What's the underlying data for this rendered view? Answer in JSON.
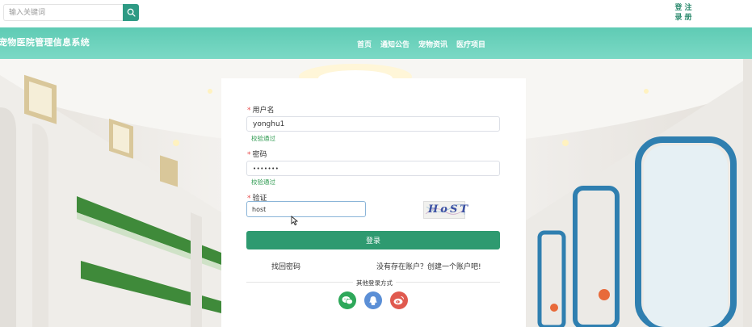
{
  "search": {
    "placeholder": "输入关键词"
  },
  "auth": {
    "login_chars": [
      "登",
      "录"
    ],
    "register_chars": [
      "注",
      "册"
    ]
  },
  "site": {
    "title": "宠物医院管理信息系统"
  },
  "nav": {
    "items": [
      "首页",
      "通知公告",
      "宠物资讯",
      "医疗项目"
    ]
  },
  "form": {
    "username": {
      "label": "用户名",
      "value": "yonghu1",
      "status": "校验通过"
    },
    "password": {
      "label": "密码",
      "value": "•••••••",
      "status": "校验通过"
    },
    "captcha": {
      "label": "验证",
      "value": "host",
      "image_text": "HoST"
    },
    "required_mark": "*",
    "submit_label": "登录",
    "forgot_label": "找回密码",
    "register_label": "没有存在账户？创建一个账户吧!",
    "other_methods_label": "其他登录方式"
  },
  "social": [
    {
      "name": "wechat-icon",
      "color": "#2ea85a"
    },
    {
      "name": "qq-icon",
      "color": "#5b8fd6"
    },
    {
      "name": "weibo-icon",
      "color": "#e05a4f"
    }
  ],
  "colors": {
    "accent": "#2e9a70",
    "header": "#6dd2bd",
    "valid": "#2e9a50",
    "required": "#e84b4b"
  }
}
